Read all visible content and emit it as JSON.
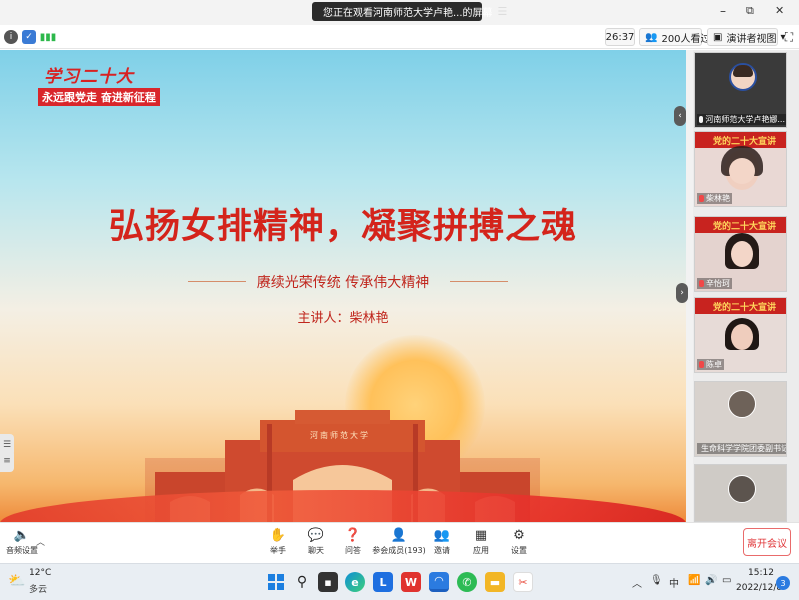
{
  "titlebar": {
    "sharing_text": "您正在观看河南师范大学卢艳...的屏幕",
    "menu_icon": "☰",
    "minimize": "–",
    "maximize": "⧉",
    "close": "✕"
  },
  "infobar": {
    "timer": "26:37",
    "viewer_count": "200人看过",
    "view_mode": "演讲者视图",
    "view_mode_icon": "▣",
    "expand_icon": "⛶"
  },
  "slide": {
    "badge_line1": "学习二十大",
    "badge_line2": "永远跟党走 奋进新征程",
    "title": "弘扬女排精神，凝聚拼搏之魂",
    "subtitle": "赓续光荣传统 传承伟大精神",
    "speaker": "主讲人：柴林艳",
    "gate_text": "河南师范大学"
  },
  "participants": [
    {
      "name": "河南师范大学卢艳娜...",
      "has_banner": false,
      "banner": ""
    },
    {
      "name": "柴林艳",
      "has_banner": true,
      "banner": "党的二十大宣讲"
    },
    {
      "name": "辛怡珂",
      "has_banner": true,
      "banner": "党的二十大宣讲"
    },
    {
      "name": "陈卓",
      "has_banner": true,
      "banner": "党的二十大宣讲"
    },
    {
      "name": "生命科学学院团委副书记...",
      "has_banner": false,
      "banner": ""
    },
    {
      "name": "",
      "has_banner": false,
      "banner": ""
    }
  ],
  "toolbar": {
    "audio_label": "音频设置",
    "raise_hand": "举手",
    "chat": "聊天",
    "qa": "问答",
    "participants": "参会成员(193)",
    "invite": "邀请",
    "apps": "应用",
    "settings": "设置",
    "leave": "离开会议"
  },
  "taskbar": {
    "weather_temp": "12°C",
    "weather_desc": "多云",
    "ime": "中",
    "time": "15:12",
    "date": "2022/12/8",
    "notification_count": "3"
  },
  "colors": {
    "accent_red": "#d4241b",
    "leave_red": "#e0383b",
    "badge_red": "#d9262b"
  }
}
